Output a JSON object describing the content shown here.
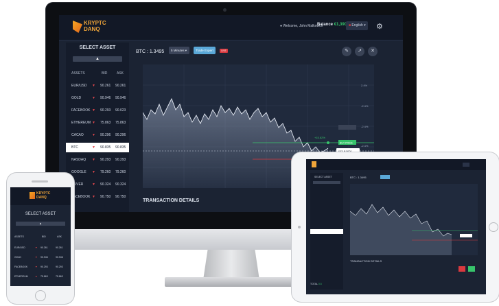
{
  "monitor": {
    "logo": {
      "line1": "KRYPTC",
      "line2": "DANQ"
    },
    "welcome": "Welcome, John Malkovich",
    "balance_label": "Balance",
    "balance_value": "€1,390",
    "language": "English",
    "select_asset_title": "SELECT ASSET",
    "headers": {
      "assets": "ASSETS",
      "bid": "BID",
      "ask": "ASK"
    },
    "assets": [
      {
        "name": "EUR/USD",
        "bid": "90.261",
        "ask": "90.261"
      },
      {
        "name": "GOLD",
        "bid": "90.946",
        "ask": "90.946"
      },
      {
        "name": "FACEBOOK",
        "bid": "90.293",
        "ask": "90.023"
      },
      {
        "name": "ETHEREUM",
        "bid": "75.863",
        "ask": "75.863"
      },
      {
        "name": "CACAO",
        "bid": "90.296",
        "ask": "90.296"
      },
      {
        "name": "BTC",
        "bid": "90.835",
        "ask": "90.835",
        "selected": true
      },
      {
        "name": "NASDAQ",
        "bid": "90.293",
        "ask": "90.293"
      },
      {
        "name": "GOOGLE",
        "bid": "79.260",
        "ask": "79.260"
      },
      {
        "name": "SILVER",
        "bid": "90.324",
        "ask": "90.324"
      },
      {
        "name": "FACEBOOK",
        "bid": "90.750",
        "ask": "90.750"
      }
    ],
    "chart_title": "BTC : 1.3495",
    "interval": "5 Minutes",
    "trade_button": "Trade Expert",
    "live_badge": "LIVE",
    "price_tag": "(93.8160)",
    "transaction_title": "TRANSACTION DETAILS",
    "right_axis": [
      "2.4%",
      "-2.4%",
      "-2.4%",
      "-2.4%",
      "-2.4%",
      "-2.4%"
    ],
    "annotations": [
      "+15.62%",
      "-15.23%"
    ],
    "buy_tag": "BUY PRICE",
    "sell_tag": "SELL PRICE"
  },
  "ipad": {
    "select_asset_title": "SELECT ASSET",
    "chart_title": "BTC : 1.3495",
    "transaction_title": "TRANSACTION DETAILS",
    "total_label": "TOTAL",
    "total_value": "0.5"
  },
  "phone": {
    "logo": {
      "line1": "KRYPTC",
      "line2": "DANQ"
    },
    "select_asset_title": "SELECT ASSET",
    "headers": {
      "assets": "ASSETS",
      "bid": "BID",
      "ask": "ASK"
    },
    "assets": [
      {
        "name": "EUR/USD",
        "bid": "90.261",
        "ask": "90.261"
      },
      {
        "name": "GOLD",
        "bid": "90.946",
        "ask": "90.946"
      },
      {
        "name": "FACEBOOK",
        "bid": "90.293",
        "ask": "90.293"
      },
      {
        "name": "ETHEREUM",
        "bid": "75.863",
        "ask": "75.863"
      }
    ]
  },
  "colors": {
    "accent": "#5aa8d8",
    "up": "#37c46b",
    "down": "#d9393f",
    "bg": "#1b2333"
  }
}
